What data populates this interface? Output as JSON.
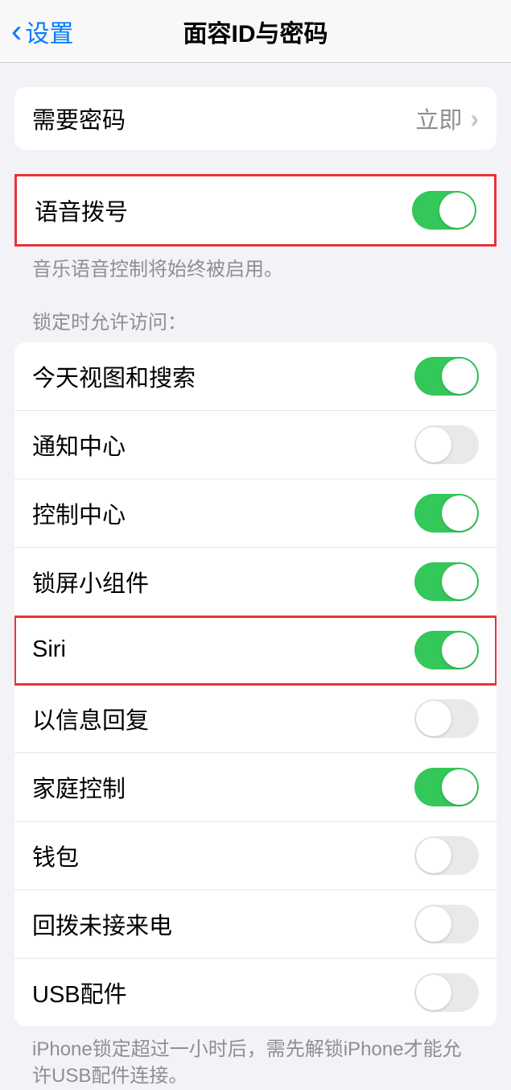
{
  "header": {
    "back_label": "设置",
    "title": "面容ID与密码"
  },
  "require_passcode": {
    "label": "需要密码",
    "value": "立即"
  },
  "voice_dial": {
    "label": "语音拨号",
    "enabled": true,
    "footer": "音乐语音控制将始终被启用。"
  },
  "locked_access": {
    "header": "锁定时允许访问：",
    "items": [
      {
        "label": "今天视图和搜索",
        "enabled": true,
        "highlight": false
      },
      {
        "label": "通知中心",
        "enabled": false,
        "highlight": false
      },
      {
        "label": "控制中心",
        "enabled": true,
        "highlight": false
      },
      {
        "label": "锁屏小组件",
        "enabled": true,
        "highlight": false
      },
      {
        "label": "Siri",
        "enabled": true,
        "highlight": true
      },
      {
        "label": "以信息回复",
        "enabled": false,
        "highlight": false
      },
      {
        "label": "家庭控制",
        "enabled": true,
        "highlight": false
      },
      {
        "label": "钱包",
        "enabled": false,
        "highlight": false
      },
      {
        "label": "回拨未接来电",
        "enabled": false,
        "highlight": false
      },
      {
        "label": "USB配件",
        "enabled": false,
        "highlight": false
      }
    ],
    "footer": "iPhone锁定超过一小时后，需先解锁iPhone才能允许USB配件连接。"
  }
}
